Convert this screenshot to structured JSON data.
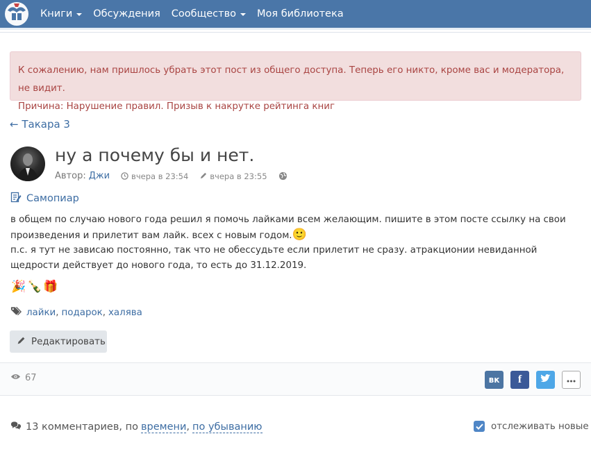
{
  "navbar": {
    "items": [
      {
        "label": "Книги",
        "dropdown": true
      },
      {
        "label": "Обсуждения",
        "dropdown": false
      },
      {
        "label": "Сообщество",
        "dropdown": true
      },
      {
        "label": "Моя библиотека",
        "dropdown": false
      }
    ],
    "colors": {
      "background": "#4a76a8",
      "text": "#ffffff"
    }
  },
  "alert": {
    "message": "К сожалению, нам пришлось убрать этот пост из общего доступа. Теперь его никто, кроме вас и модератора, не видит.",
    "reason": "Причина: Нарушение правил. Призыв к накрутке рейтинга книг",
    "colors": {
      "background": "#f2dede",
      "text": "#a94442"
    }
  },
  "back_link": "← Такара 3",
  "post": {
    "title": "ну а почему бы и нет.",
    "author_prefix": "Автор:",
    "author": "Джи",
    "created": "вчера в 23:54",
    "edited": "вчера в 23:55",
    "category": "Самопиар",
    "body_line1": "в общем по случаю нового года решил я помочь лайками всем желающим. пишите в этом посте ссылку на свои произведения и прилетит вам лайк. всех с новым годом.",
    "body_emoji": "🙂",
    "body_line2": "п.с. я тут не зависаю постоянно, так что не обессудьте если прилетит не сразу. атракционии невиданной щедрости действует до нового года, то есть до 31.12.2019.",
    "emojis": [
      "🎉",
      "🍾",
      "🎁"
    ],
    "tags": [
      "лайки",
      "подарок",
      "халява"
    ],
    "edit_label": "Редактировать"
  },
  "footer": {
    "views": "67",
    "share": {
      "vk": "вк",
      "fb": "f"
    }
  },
  "comments": {
    "count_text": "13 комментариев, по",
    "sort_time": "времени",
    "sort_sep": ",",
    "sort_order": "по убыванию",
    "follow_label": "отслеживать новые"
  }
}
